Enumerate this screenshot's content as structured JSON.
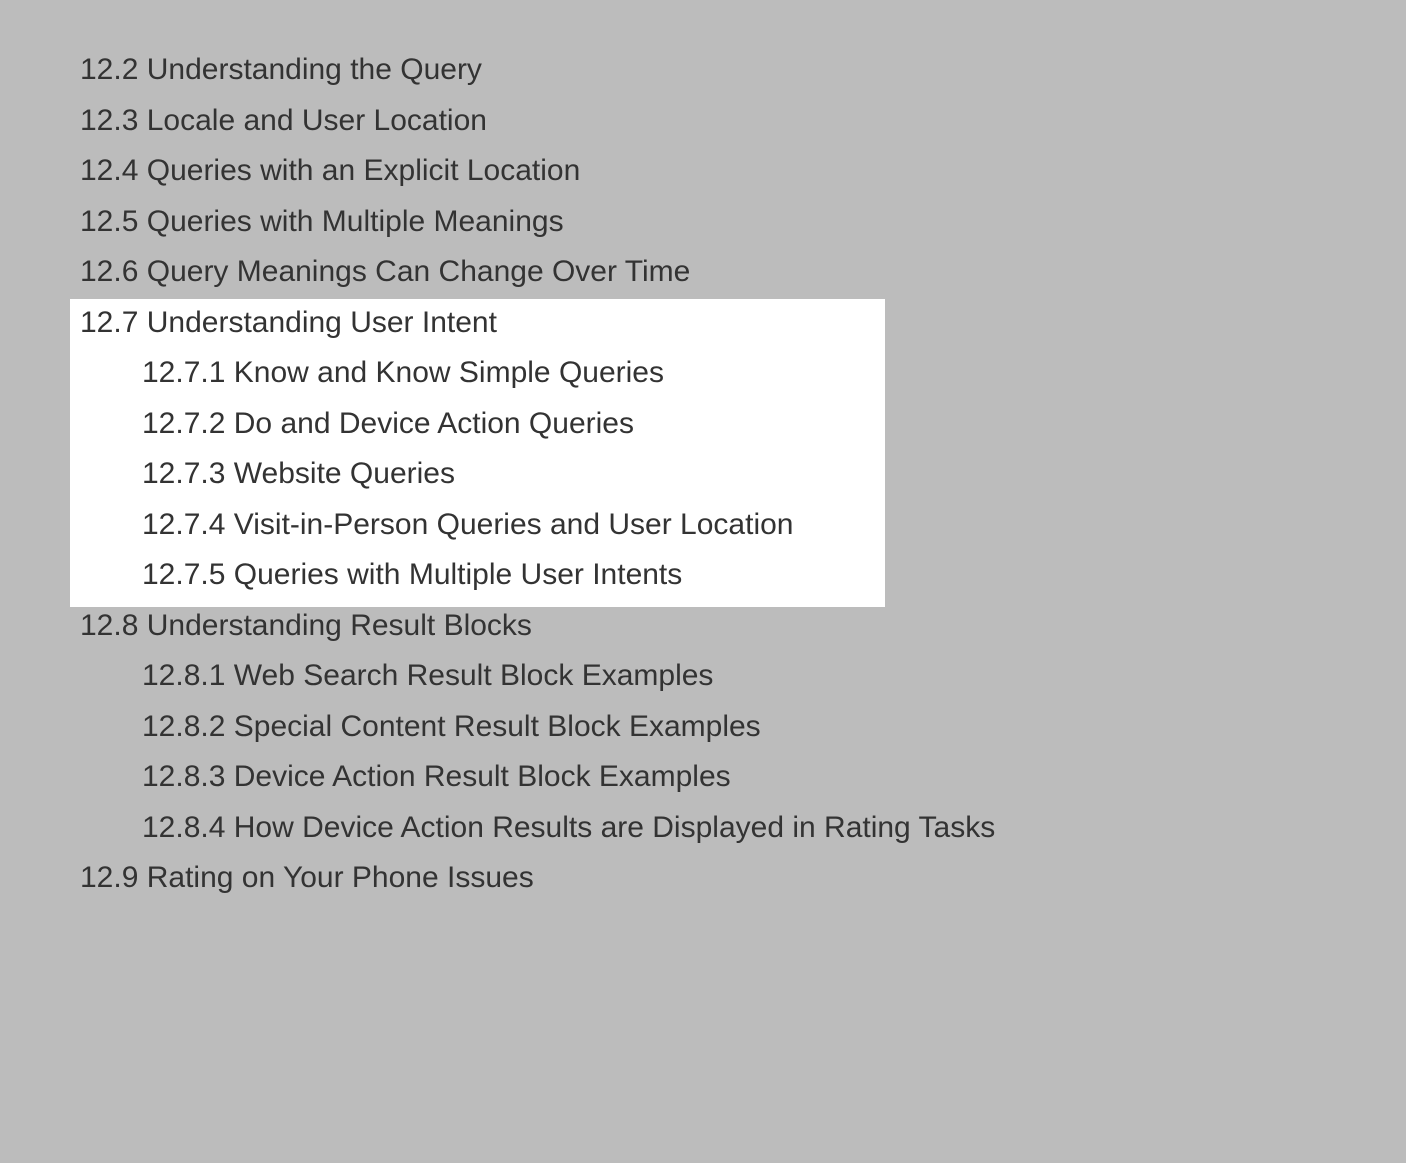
{
  "toc": {
    "lines": [
      {
        "level": 1,
        "number": "12.2",
        "title": "Understanding the Query"
      },
      {
        "level": 1,
        "number": "12.3",
        "title": "Locale and User Location"
      },
      {
        "level": 1,
        "number": "12.4",
        "title": "Queries with an Explicit Location"
      },
      {
        "level": 1,
        "number": "12.5",
        "title": "Queries with Multiple Meanings"
      },
      {
        "level": 1,
        "number": "12.6",
        "title": "Query Meanings Can Change Over Time"
      },
      {
        "level": 1,
        "number": "12.7",
        "title": "Understanding User Intent"
      },
      {
        "level": 2,
        "number": "12.7.1",
        "title": "Know and Know Simple Queries"
      },
      {
        "level": 2,
        "number": "12.7.2",
        "title": "Do and Device Action Queries"
      },
      {
        "level": 2,
        "number": "12.7.3",
        "title": "Website Queries"
      },
      {
        "level": 2,
        "number": "12.7.4",
        "title": "Visit-in-Person Queries and User Location"
      },
      {
        "level": 2,
        "number": "12.7.5",
        "title": "Queries with Multiple User Intents"
      },
      {
        "level": 1,
        "number": "12.8",
        "title": "Understanding Result Blocks"
      },
      {
        "level": 2,
        "number": "12.8.1",
        "title": "Web Search Result Block Examples"
      },
      {
        "level": 2,
        "number": "12.8.2",
        "title": "Special Content Result Block Examples"
      },
      {
        "level": 2,
        "number": "12.8.3",
        "title": "Device Action Result Block Examples"
      },
      {
        "level": 2,
        "number": "12.8.4",
        "title": "How Device Action Results are Displayed in Rating Tasks"
      },
      {
        "level": 1,
        "number": "12.9",
        "title": "Rating on Your Phone Issues"
      }
    ],
    "highlight_start": 5,
    "highlight_end": 10
  }
}
